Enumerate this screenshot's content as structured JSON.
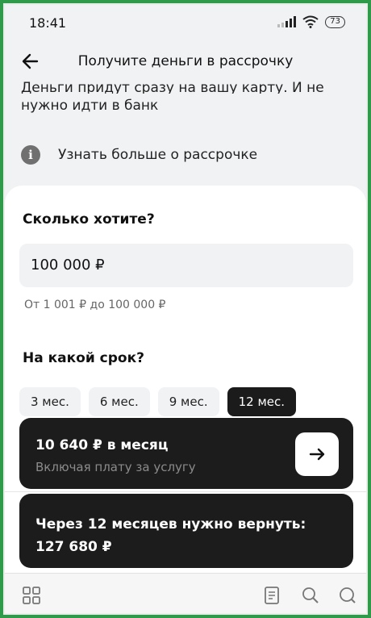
{
  "status_bar": {
    "time": "18:41",
    "battery": "73"
  },
  "header": {
    "title": "Получите деньги в рассрочку"
  },
  "intro": {
    "line1": "Деньги придут сразу на вашу карту. И не",
    "line2": "нужно идти в банк"
  },
  "info": {
    "label": "Узнать больше о рассрочке",
    "icon": "info-icon"
  },
  "amount_section": {
    "question": "Сколько хотите?",
    "value": "100 000 ₽",
    "hint": "От 1 001 ₽ до 100 000 ₽"
  },
  "term_section": {
    "question": "На какой срок?",
    "options": [
      "3 мес.",
      "6 мес.",
      "9 мес.",
      "12 мес."
    ],
    "selected": "12 мес."
  },
  "monthly_card": {
    "amount": "10 640 ₽ в месяц",
    "subtitle": "Включая плату за услугу"
  },
  "total_card": {
    "line1": "Через 12 месяцев нужно вернуть:",
    "line2": "127 680 ₽"
  },
  "bottom_nav": {
    "icons": [
      "grid-icon",
      "document-icon",
      "search-icon",
      "chat-icon"
    ]
  },
  "colors": {
    "frame_border": "#2f9a4a",
    "screen_bg": "#f1f2f4",
    "dark_card": "#1c1c1c",
    "muted_text": "#8b8b8b"
  }
}
